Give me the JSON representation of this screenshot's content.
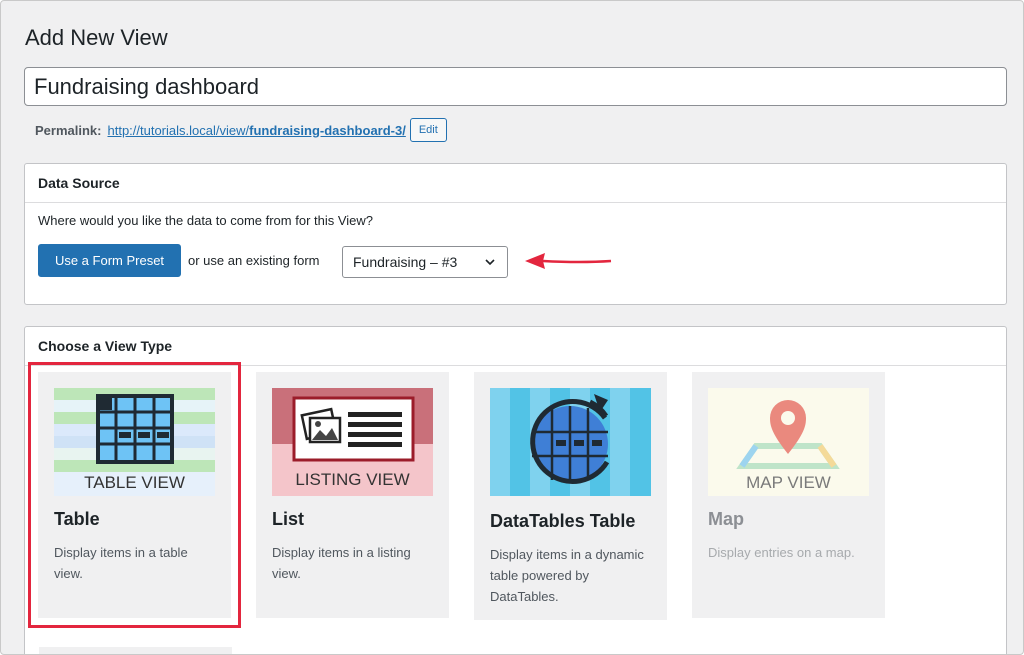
{
  "page": {
    "title": "Add New View",
    "view_name": "Fundraising dashboard"
  },
  "permalink": {
    "label": "Permalink:",
    "url_base": "http://tutorials.local/view/",
    "url_slug": "fundraising-dashboard-3/",
    "edit_label": "Edit"
  },
  "data_source": {
    "header": "Data Source",
    "question": "Where would you like the data to come from for this View?",
    "preset_button": "Use a Form Preset",
    "or_text": "or use an existing form",
    "selected_form": "Fundraising – #3"
  },
  "view_type": {
    "header": "Choose a View Type",
    "cards": [
      {
        "name": "Table",
        "description": "Display items in a table view.",
        "thumb_label": "TABLE VIEW",
        "thumb_icon": "table-grid-icon"
      },
      {
        "name": "List",
        "description": "Display items in a listing view.",
        "thumb_label": "LISTING VIEW",
        "thumb_icon": "listing-document-icon"
      },
      {
        "name": "DataTables Table",
        "description": "Display items in a dynamic table powered by DataTables.",
        "thumb_label": "",
        "thumb_icon": "refresh-globe-grid-icon"
      },
      {
        "name": "Map",
        "description": "Display entries on a map.",
        "thumb_label": "MAP VIEW",
        "thumb_icon": "map-pin-icon",
        "disabled": true
      }
    ]
  },
  "annotations": {
    "highlight_color": "#e3263e",
    "arrow_color": "#e3263e"
  },
  "colors": {
    "primary": "#2271b1",
    "background": "#f0f0f1"
  }
}
